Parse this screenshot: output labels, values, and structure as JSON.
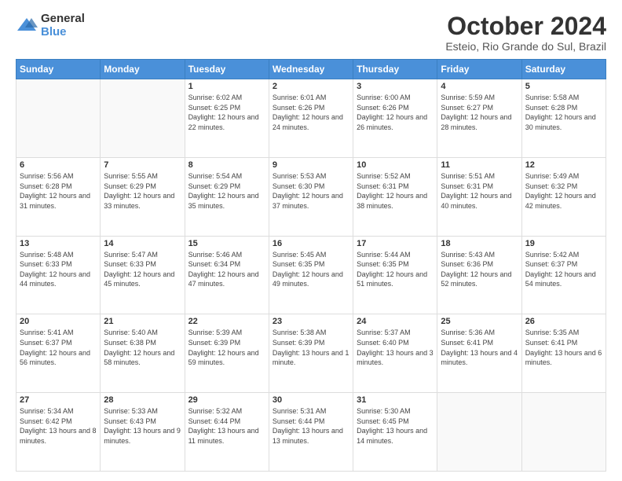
{
  "logo": {
    "general": "General",
    "blue": "Blue"
  },
  "title": "October 2024",
  "subtitle": "Esteio, Rio Grande do Sul, Brazil",
  "days_of_week": [
    "Sunday",
    "Monday",
    "Tuesday",
    "Wednesday",
    "Thursday",
    "Friday",
    "Saturday"
  ],
  "weeks": [
    [
      {
        "day": "",
        "sunrise": "",
        "sunset": "",
        "daylight": ""
      },
      {
        "day": "",
        "sunrise": "",
        "sunset": "",
        "daylight": ""
      },
      {
        "day": "1",
        "sunrise": "Sunrise: 6:02 AM",
        "sunset": "Sunset: 6:25 PM",
        "daylight": "Daylight: 12 hours and 22 minutes."
      },
      {
        "day": "2",
        "sunrise": "Sunrise: 6:01 AM",
        "sunset": "Sunset: 6:26 PM",
        "daylight": "Daylight: 12 hours and 24 minutes."
      },
      {
        "day": "3",
        "sunrise": "Sunrise: 6:00 AM",
        "sunset": "Sunset: 6:26 PM",
        "daylight": "Daylight: 12 hours and 26 minutes."
      },
      {
        "day": "4",
        "sunrise": "Sunrise: 5:59 AM",
        "sunset": "Sunset: 6:27 PM",
        "daylight": "Daylight: 12 hours and 28 minutes."
      },
      {
        "day": "5",
        "sunrise": "Sunrise: 5:58 AM",
        "sunset": "Sunset: 6:28 PM",
        "daylight": "Daylight: 12 hours and 30 minutes."
      }
    ],
    [
      {
        "day": "6",
        "sunrise": "Sunrise: 5:56 AM",
        "sunset": "Sunset: 6:28 PM",
        "daylight": "Daylight: 12 hours and 31 minutes."
      },
      {
        "day": "7",
        "sunrise": "Sunrise: 5:55 AM",
        "sunset": "Sunset: 6:29 PM",
        "daylight": "Daylight: 12 hours and 33 minutes."
      },
      {
        "day": "8",
        "sunrise": "Sunrise: 5:54 AM",
        "sunset": "Sunset: 6:29 PM",
        "daylight": "Daylight: 12 hours and 35 minutes."
      },
      {
        "day": "9",
        "sunrise": "Sunrise: 5:53 AM",
        "sunset": "Sunset: 6:30 PM",
        "daylight": "Daylight: 12 hours and 37 minutes."
      },
      {
        "day": "10",
        "sunrise": "Sunrise: 5:52 AM",
        "sunset": "Sunset: 6:31 PM",
        "daylight": "Daylight: 12 hours and 38 minutes."
      },
      {
        "day": "11",
        "sunrise": "Sunrise: 5:51 AM",
        "sunset": "Sunset: 6:31 PM",
        "daylight": "Daylight: 12 hours and 40 minutes."
      },
      {
        "day": "12",
        "sunrise": "Sunrise: 5:49 AM",
        "sunset": "Sunset: 6:32 PM",
        "daylight": "Daylight: 12 hours and 42 minutes."
      }
    ],
    [
      {
        "day": "13",
        "sunrise": "Sunrise: 5:48 AM",
        "sunset": "Sunset: 6:33 PM",
        "daylight": "Daylight: 12 hours and 44 minutes."
      },
      {
        "day": "14",
        "sunrise": "Sunrise: 5:47 AM",
        "sunset": "Sunset: 6:33 PM",
        "daylight": "Daylight: 12 hours and 45 minutes."
      },
      {
        "day": "15",
        "sunrise": "Sunrise: 5:46 AM",
        "sunset": "Sunset: 6:34 PM",
        "daylight": "Daylight: 12 hours and 47 minutes."
      },
      {
        "day": "16",
        "sunrise": "Sunrise: 5:45 AM",
        "sunset": "Sunset: 6:35 PM",
        "daylight": "Daylight: 12 hours and 49 minutes."
      },
      {
        "day": "17",
        "sunrise": "Sunrise: 5:44 AM",
        "sunset": "Sunset: 6:35 PM",
        "daylight": "Daylight: 12 hours and 51 minutes."
      },
      {
        "day": "18",
        "sunrise": "Sunrise: 5:43 AM",
        "sunset": "Sunset: 6:36 PM",
        "daylight": "Daylight: 12 hours and 52 minutes."
      },
      {
        "day": "19",
        "sunrise": "Sunrise: 5:42 AM",
        "sunset": "Sunset: 6:37 PM",
        "daylight": "Daylight: 12 hours and 54 minutes."
      }
    ],
    [
      {
        "day": "20",
        "sunrise": "Sunrise: 5:41 AM",
        "sunset": "Sunset: 6:37 PM",
        "daylight": "Daylight: 12 hours and 56 minutes."
      },
      {
        "day": "21",
        "sunrise": "Sunrise: 5:40 AM",
        "sunset": "Sunset: 6:38 PM",
        "daylight": "Daylight: 12 hours and 58 minutes."
      },
      {
        "day": "22",
        "sunrise": "Sunrise: 5:39 AM",
        "sunset": "Sunset: 6:39 PM",
        "daylight": "Daylight: 12 hours and 59 minutes."
      },
      {
        "day": "23",
        "sunrise": "Sunrise: 5:38 AM",
        "sunset": "Sunset: 6:39 PM",
        "daylight": "Daylight: 13 hours and 1 minute."
      },
      {
        "day": "24",
        "sunrise": "Sunrise: 5:37 AM",
        "sunset": "Sunset: 6:40 PM",
        "daylight": "Daylight: 13 hours and 3 minutes."
      },
      {
        "day": "25",
        "sunrise": "Sunrise: 5:36 AM",
        "sunset": "Sunset: 6:41 PM",
        "daylight": "Daylight: 13 hours and 4 minutes."
      },
      {
        "day": "26",
        "sunrise": "Sunrise: 5:35 AM",
        "sunset": "Sunset: 6:41 PM",
        "daylight": "Daylight: 13 hours and 6 minutes."
      }
    ],
    [
      {
        "day": "27",
        "sunrise": "Sunrise: 5:34 AM",
        "sunset": "Sunset: 6:42 PM",
        "daylight": "Daylight: 13 hours and 8 minutes."
      },
      {
        "day": "28",
        "sunrise": "Sunrise: 5:33 AM",
        "sunset": "Sunset: 6:43 PM",
        "daylight": "Daylight: 13 hours and 9 minutes."
      },
      {
        "day": "29",
        "sunrise": "Sunrise: 5:32 AM",
        "sunset": "Sunset: 6:44 PM",
        "daylight": "Daylight: 13 hours and 11 minutes."
      },
      {
        "day": "30",
        "sunrise": "Sunrise: 5:31 AM",
        "sunset": "Sunset: 6:44 PM",
        "daylight": "Daylight: 13 hours and 13 minutes."
      },
      {
        "day": "31",
        "sunrise": "Sunrise: 5:30 AM",
        "sunset": "Sunset: 6:45 PM",
        "daylight": "Daylight: 13 hours and 14 minutes."
      },
      {
        "day": "",
        "sunrise": "",
        "sunset": "",
        "daylight": ""
      },
      {
        "day": "",
        "sunrise": "",
        "sunset": "",
        "daylight": ""
      }
    ]
  ]
}
